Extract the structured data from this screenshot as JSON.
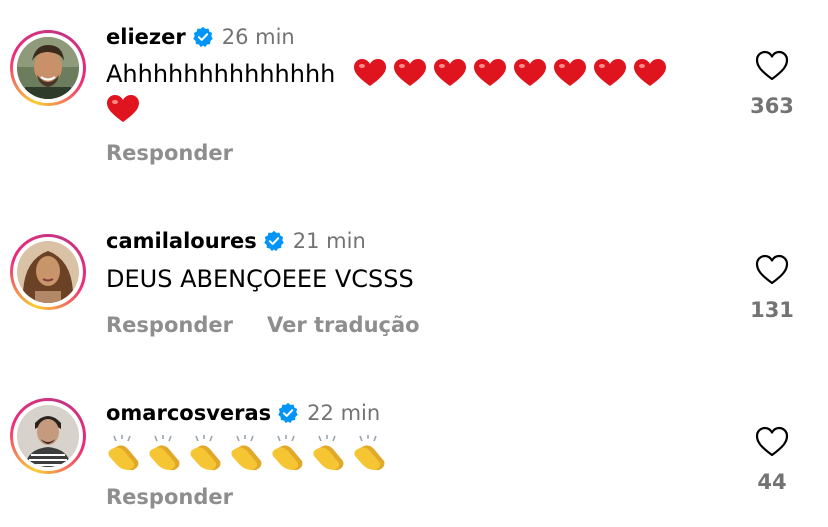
{
  "comments": [
    {
      "username": "eliezer",
      "time": "26 min",
      "text": "Ahhhhhhhhhhhhhh",
      "emoji": "red-heart",
      "emoji_count_line1": 8,
      "emoji_count_line2": 1,
      "actions": [
        "Responder"
      ],
      "likes": "363"
    },
    {
      "username": "camilaloures",
      "time": "21 min",
      "text": "DEUS ABENÇOEEE VCSSS",
      "actions": [
        "Responder",
        "Ver tradução"
      ],
      "likes": "131"
    },
    {
      "username": "omarcosveras",
      "time": "22 min",
      "text": "",
      "emoji": "clapping-hands",
      "emoji_count_line1": 7,
      "actions": [
        "Responder"
      ],
      "likes": "44"
    }
  ],
  "colors": {
    "verified": "#0095f6",
    "heart_emoji": "#e0141e",
    "clap_emoji": "#f6c533",
    "muted_text": "#737373",
    "action_text": "#8e8e8e"
  },
  "icons": {
    "verified": "verified-badge-icon",
    "like": "heart-outline-icon"
  }
}
